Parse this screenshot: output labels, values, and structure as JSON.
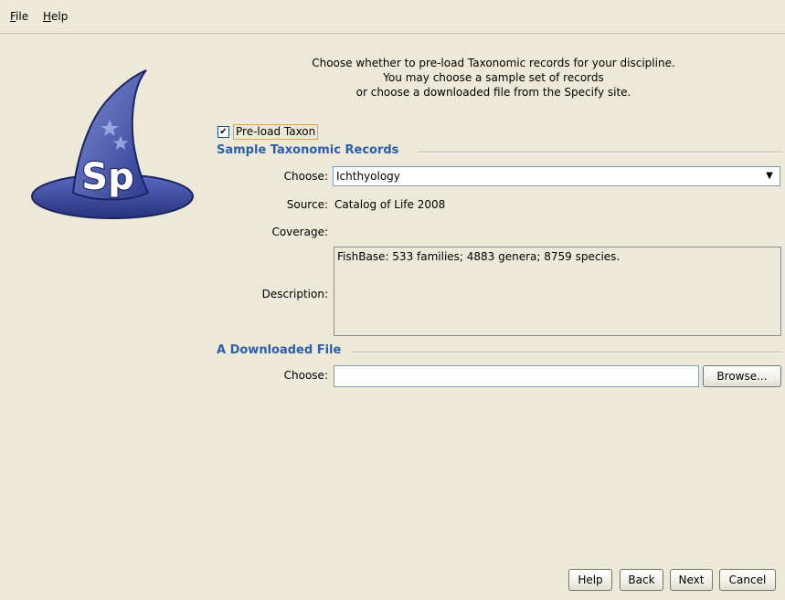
{
  "menu": {
    "items": [
      {
        "mnemonic": "F",
        "rest": "ile"
      },
      {
        "mnemonic": "H",
        "rest": "elp"
      }
    ]
  },
  "logo": {
    "text": "Sp"
  },
  "intro": {
    "line1": "Choose whether to pre-load Taxonomic records for your discipline.",
    "line2": "You may choose a sample set of records",
    "line3": "or choose a downloaded file from the Specify site."
  },
  "preload": {
    "label": "Pre-load Taxon",
    "checked": true,
    "check_glyph": "✔"
  },
  "sample_section": {
    "title": "Sample Taxonomic Records",
    "choose_label": "Choose:",
    "choose_value": "Ichthyology",
    "source_label": "Source:",
    "source_value": "Catalog of Life 2008",
    "coverage_label": "Coverage:",
    "coverage_value": "",
    "description_label": "Description:",
    "description_value": "FishBase: 533 families; 4883 genera; 8759 species."
  },
  "download_section": {
    "title": "A Downloaded File",
    "choose_label": "Choose:",
    "file_value": "",
    "browse_label": "Browse..."
  },
  "buttons": {
    "help": "Help",
    "back": "Back",
    "next": "Next",
    "cancel": "Cancel"
  },
  "colors": {
    "section_title": "#2b5fab",
    "hat": "#3b4ea6",
    "focus_border": "#e8a33c"
  }
}
